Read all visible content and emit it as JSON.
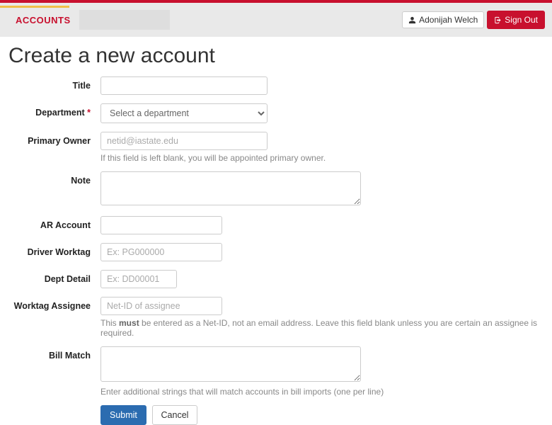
{
  "nav": {
    "brand": "ACCOUNTS",
    "user_name": "Adonijah Welch",
    "signout_label": "Sign Out"
  },
  "page": {
    "title": "Create a new account"
  },
  "labels": {
    "title": "Title",
    "department": "Department",
    "department_req": "*",
    "primary_owner": "Primary Owner",
    "note": "Note",
    "ar_account": "AR Account",
    "driver_worktag": "Driver Worktag",
    "dept_detail": "Dept Detail",
    "worktag_assignee": "Worktag Assignee",
    "bill_match": "Bill Match"
  },
  "placeholders": {
    "department_select": "Select a department",
    "primary_owner": "netid@iastate.edu",
    "driver_worktag": "Ex: PG000000",
    "dept_detail": "Ex: DD00001",
    "worktag_assignee": "Net-ID of assignee"
  },
  "help": {
    "primary_owner": "If this field is left blank, you will be appointed primary owner.",
    "worktag_assignee_pre": "This ",
    "worktag_assignee_bold": "must",
    "worktag_assignee_post": " be entered as a Net-ID, not an email address. Leave this field blank unless you are certain an assignee is required.",
    "bill_match": "Enter additional strings that will match accounts in bill imports (one per line)"
  },
  "buttons": {
    "submit": "Submit",
    "cancel": "Cancel"
  }
}
